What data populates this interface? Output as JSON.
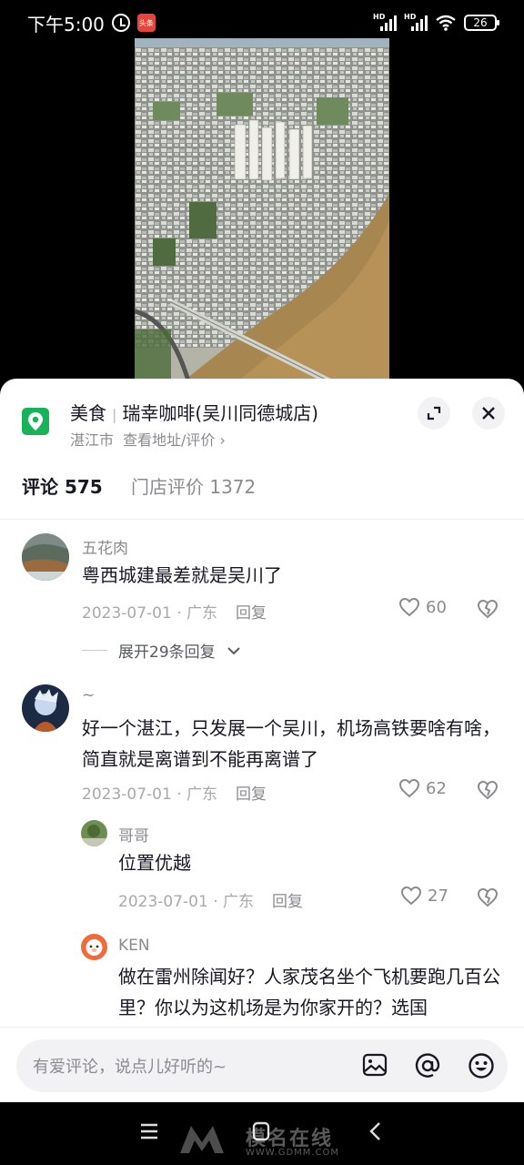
{
  "status_bar": {
    "time": "下午5:00",
    "app_badge": "头条",
    "network_1": "HD",
    "network_2": "HD",
    "battery": "26"
  },
  "poi": {
    "category": "美食",
    "name": "瑞幸咖啡(吴川同德城店)",
    "city": "湛江市",
    "link": "查看地址/评价 ›"
  },
  "tabs": {
    "comments": "评论 575",
    "reviews": "门店评价 1372"
  },
  "comments": [
    {
      "author": "五花肉",
      "text": "粤西城建最差就是吴川了",
      "date": "2023-07-01 · 广东",
      "reply": "回复",
      "likes": "60",
      "expand": "展开29条回复"
    },
    {
      "author": "~",
      "text": "好一个湛江，只发展一个吴川，机场高铁要啥有啥，简直就是离谱到不能再离谱了",
      "date": "2023-07-01 · 广东",
      "reply": "回复",
      "likes": "62"
    }
  ],
  "replies": [
    {
      "author": "哥哥",
      "text": "位置优越",
      "date": "2023-07-01 · 广东",
      "reply": "回复",
      "likes": "27"
    },
    {
      "author": "KEN",
      "text": "做在雷州除闻好？人家茂名坐个飞机要跑几百公里？你以为这机场是为你家开的？选国"
    }
  ],
  "input": {
    "placeholder": "有爱评论，说点儿好听的~"
  },
  "watermark": {
    "name": "模名在线",
    "url": "WWW.GDMM.COM"
  },
  "colors": {
    "poi_green": "#17b35a",
    "text_primary": "#161823",
    "text_secondary": "#8a8b91"
  }
}
